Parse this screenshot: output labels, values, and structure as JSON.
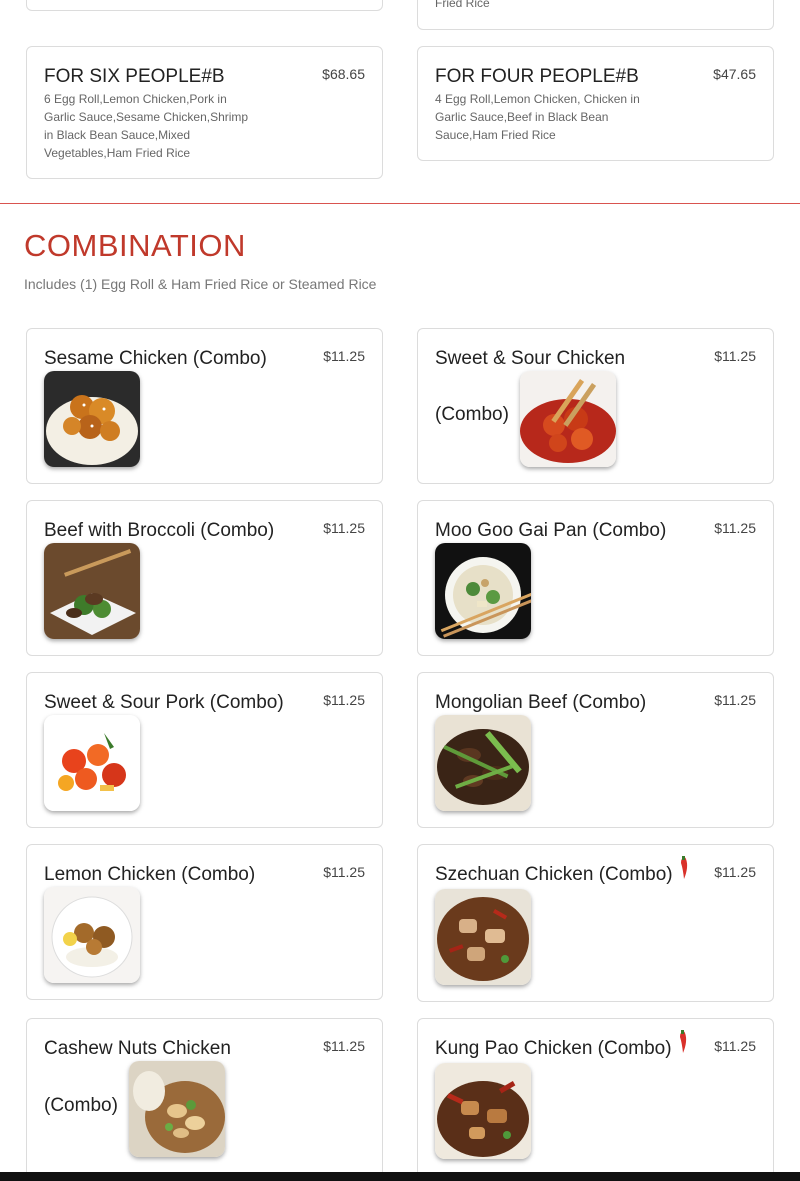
{
  "top_partial": {
    "right_desc_tail": "Fried Rice"
  },
  "family": [
    {
      "name": "FOR SIX PEOPLE#B",
      "price": "$68.65",
      "desc": "6 Egg Roll,Lemon Chicken,Pork in Garlic Sauce,Sesame Chicken,Shrimp in Black Bean Sauce,Mixed Vegetables,Ham Fried Rice"
    },
    {
      "name": "FOR FOUR PEOPLE#B",
      "price": "$47.65",
      "desc": "4 Egg Roll,Lemon Chicken, Chicken in Garlic Sauce,Beef in Black Bean Sauce,Ham Fried Rice"
    }
  ],
  "section": {
    "title": "COMBINATION",
    "subtitle": "Includes (1) Egg Roll & Ham Fried Rice or Steamed Rice"
  },
  "items": [
    {
      "name": "Sesame Chicken (Combo)",
      "price": "$11.25",
      "icon": "sesame-chicken-photo"
    },
    {
      "name": "Sweet & Sour Chicken",
      "name2": "(Combo)",
      "price": "$11.25",
      "icon": "sweet-sour-chicken-photo"
    },
    {
      "name": "Beef with Broccoli (Combo)",
      "price": "$11.25",
      "icon": "beef-broccoli-photo"
    },
    {
      "name": "Moo Goo Gai Pan (Combo)",
      "price": "$11.25",
      "icon": "moo-goo-gai-pan-photo"
    },
    {
      "name": "Sweet & Sour Pork (Combo)",
      "price": "$11.25",
      "icon": "sweet-sour-pork-photo"
    },
    {
      "name": "Mongolian Beef (Combo)",
      "price": "$11.25",
      "icon": "mongolian-beef-photo"
    },
    {
      "name": "Lemon Chicken (Combo)",
      "price": "$11.25",
      "icon": "lemon-chicken-photo"
    },
    {
      "name": "Szechuan Chicken (Combo)",
      "price": "$11.25",
      "spicy": true,
      "icon": "szechuan-chicken-photo"
    },
    {
      "name": "Cashew Nuts Chicken",
      "name2": "(Combo)",
      "price": "$11.25",
      "icon": "cashew-chicken-photo"
    },
    {
      "name": "Kung Pao Chicken (Combo)",
      "price": "$11.25",
      "spicy": true,
      "icon": "kung-pao-chicken-photo"
    }
  ],
  "colors": {
    "accent": "#c0392b",
    "card_border": "#dcdcdc",
    "chili": "#d9312b"
  }
}
